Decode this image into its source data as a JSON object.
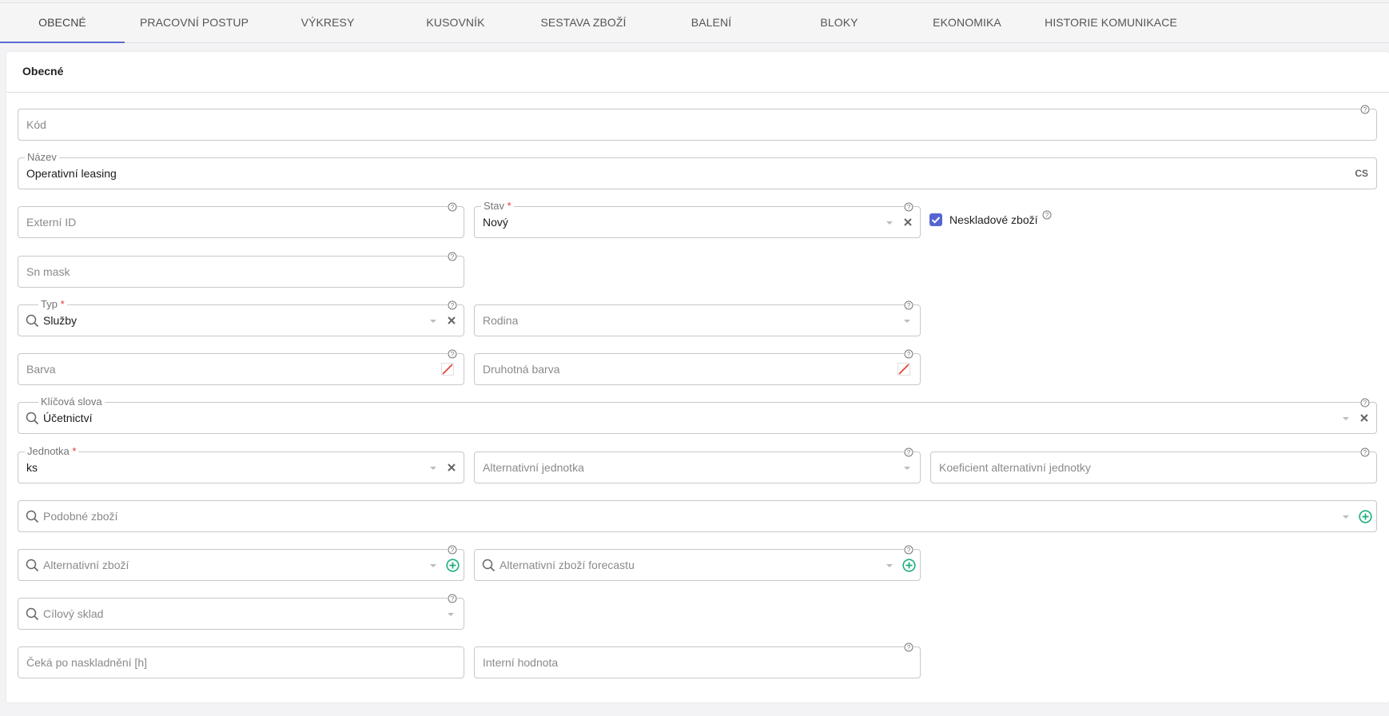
{
  "tabs": [
    {
      "label": "OBECNÉ",
      "active": true
    },
    {
      "label": "PRACOVNÍ POSTUP"
    },
    {
      "label": "VÝKRESY"
    },
    {
      "label": "KUSOVNÍK"
    },
    {
      "label": "SESTAVA ZBOŽÍ"
    },
    {
      "label": "BALENÍ"
    },
    {
      "label": "BLOKY"
    },
    {
      "label": "EKONOMIKA"
    },
    {
      "label": "HISTORIE KOMUNIKACE"
    }
  ],
  "section": {
    "title": "Obecné"
  },
  "fields": {
    "kod": {
      "placeholder": "Kód"
    },
    "nazev": {
      "label": "Název",
      "value": "Operativní leasing",
      "lang": "CS"
    },
    "externi_id": {
      "placeholder": "Externí ID"
    },
    "stav": {
      "label": "Stav",
      "required": "*",
      "value": "Nový"
    },
    "neskladove": {
      "label": "Neskladové zboží",
      "checked": true
    },
    "sn_mask": {
      "placeholder": "Sn mask"
    },
    "typ": {
      "label": "Typ",
      "required": "*",
      "value": "Služby"
    },
    "rodina": {
      "placeholder": "Rodina"
    },
    "barva": {
      "placeholder": "Barva"
    },
    "druhotna_barva": {
      "placeholder": "Druhotná barva"
    },
    "klicova_slova": {
      "label": "Klíčová slova",
      "value": "Účetnictví"
    },
    "jednotka": {
      "label": "Jednotka",
      "required": "*",
      "value": "ks"
    },
    "alt_jednotka": {
      "placeholder": "Alternativní jednotka"
    },
    "koeficient": {
      "placeholder": "Koeficient alternativní jednotky"
    },
    "podobne_zbozi": {
      "placeholder": "Podobné zboží"
    },
    "alternativni_zbozi": {
      "placeholder": "Alternativní zboží"
    },
    "alt_zbozi_forecast": {
      "placeholder": "Alternativní zboží forecastu"
    },
    "cilovy_sklad": {
      "placeholder": "Cílový sklad"
    },
    "ceka": {
      "placeholder": "Čeká po naskladnění [h]"
    },
    "interni_hodnota": {
      "placeholder": "Interní hodnota"
    }
  },
  "colors": {
    "accent": "#5b6bd5",
    "add": "#1aae7a",
    "required": "#e53935",
    "no_color": "#e53935"
  }
}
